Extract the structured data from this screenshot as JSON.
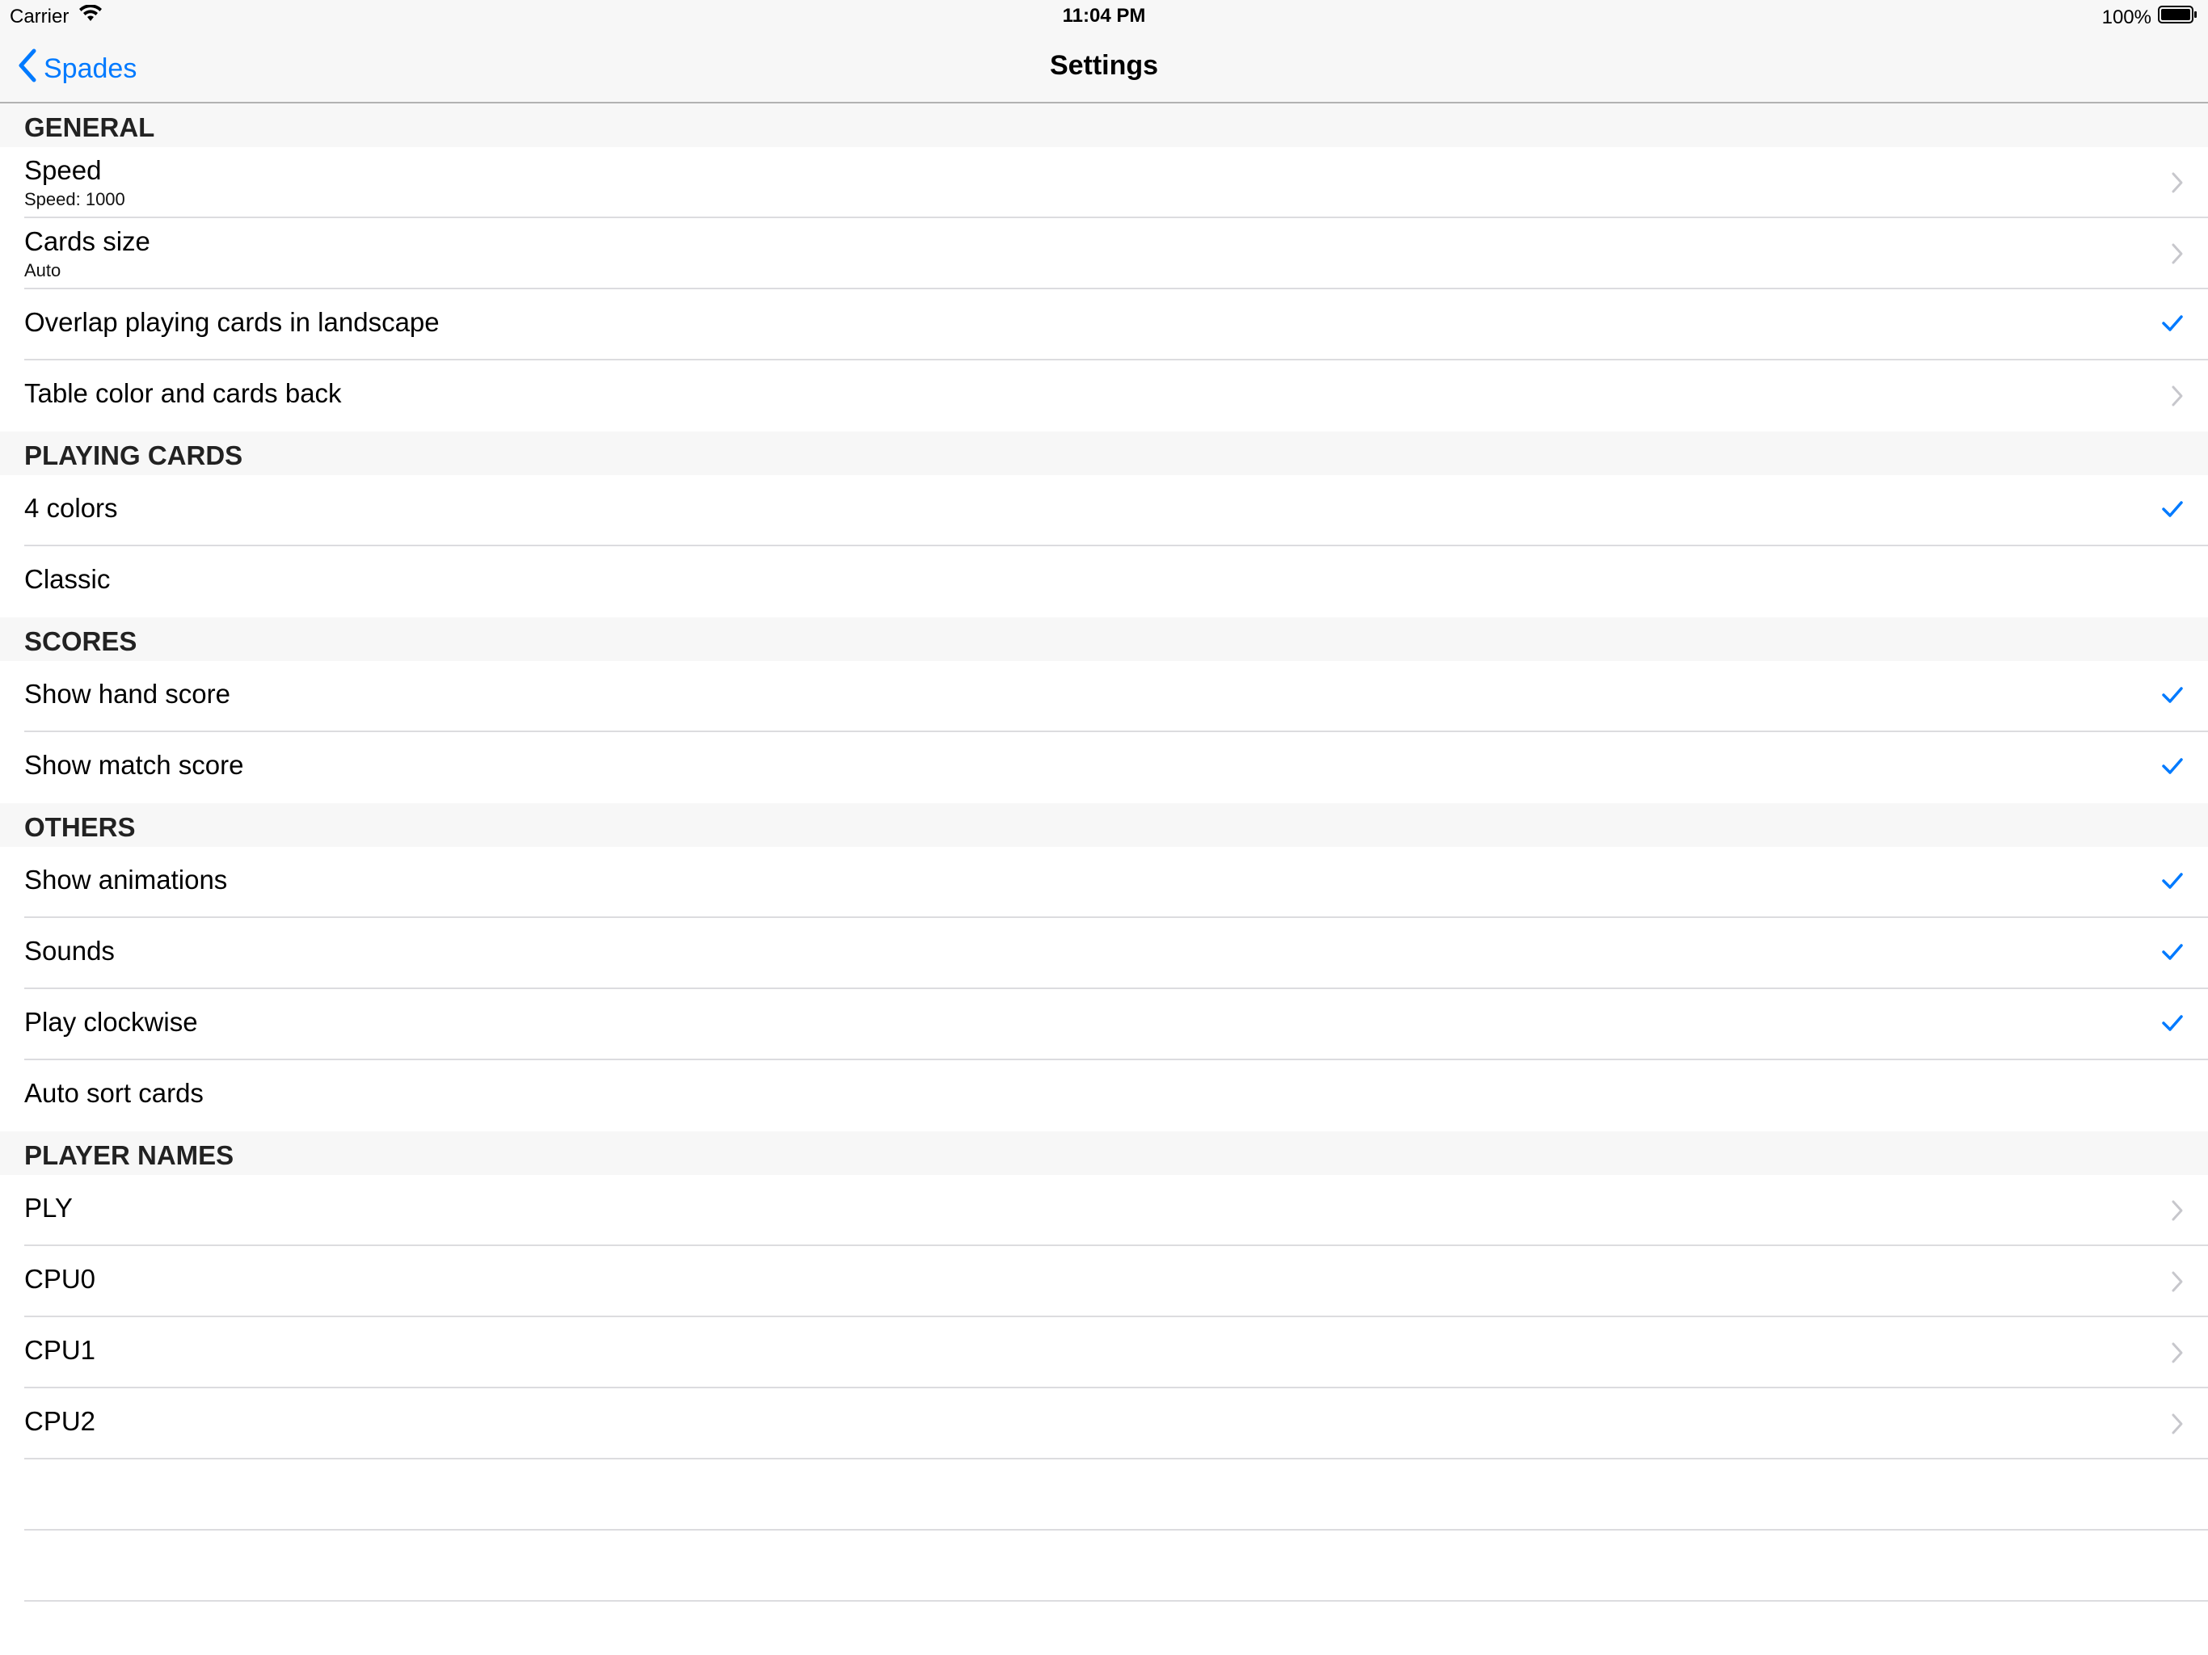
{
  "status_bar": {
    "carrier": "Carrier",
    "time": "11:04 PM",
    "battery": "100%"
  },
  "nav": {
    "back_label": "Spades",
    "title": "Settings"
  },
  "colors": {
    "accent": "#007aff",
    "separator": "#dcdcdf",
    "section_bg": "#f7f7f7"
  },
  "sections": [
    {
      "title": "GENERAL",
      "rows": [
        {
          "label": "Speed",
          "subtitle": "Speed: 1000",
          "accessory": "chevron"
        },
        {
          "label": "Cards size",
          "subtitle": "Auto",
          "accessory": "chevron"
        },
        {
          "label": "Overlap playing cards in landscape",
          "accessory": "check"
        },
        {
          "label": "Table color and cards back",
          "accessory": "chevron"
        }
      ]
    },
    {
      "title": "PLAYING CARDS",
      "rows": [
        {
          "label": "4 colors",
          "accessory": "check"
        },
        {
          "label": "Classic",
          "accessory": "none"
        }
      ]
    },
    {
      "title": "SCORES",
      "rows": [
        {
          "label": "Show hand score",
          "accessory": "check"
        },
        {
          "label": "Show match score",
          "accessory": "check"
        }
      ]
    },
    {
      "title": "OTHERS",
      "rows": [
        {
          "label": "Show animations",
          "accessory": "check"
        },
        {
          "label": "Sounds",
          "accessory": "check"
        },
        {
          "label": "Play clockwise",
          "accessory": "check"
        },
        {
          "label": "Auto sort cards",
          "accessory": "none"
        }
      ]
    },
    {
      "title": "PLAYER NAMES",
      "rows": [
        {
          "label": "PLY",
          "accessory": "chevron"
        },
        {
          "label": "CPU0",
          "accessory": "chevron"
        },
        {
          "label": "CPU1",
          "accessory": "chevron"
        },
        {
          "label": "CPU2",
          "accessory": "chevron"
        }
      ]
    }
  ]
}
